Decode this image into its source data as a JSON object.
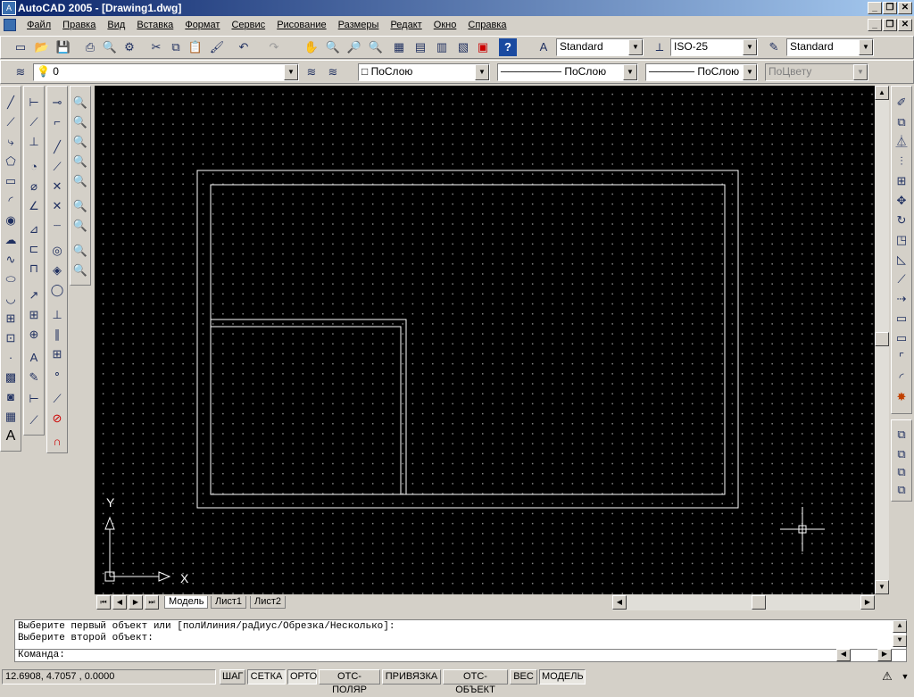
{
  "title": "AutoCAD 2005 - [Drawing1.dwg]",
  "window_controls": [
    "_",
    "❐",
    "✕"
  ],
  "menu": [
    "Файл",
    "Правка",
    "Вид",
    "Вставка",
    "Формат",
    "Сервис",
    "Рисование",
    "Размеры",
    "Редакт",
    "Окно",
    "Справка"
  ],
  "toolbar": {
    "text_style": "Standard",
    "dim_style": "ISO-25",
    "table_style": "Standard",
    "layer": "0",
    "color": "ПоСлою",
    "linetype": "ПоСлою",
    "lineweight": "ПоСлою",
    "plotstyle": "ПоЦвету"
  },
  "tabs": [
    "Модель",
    "Лист1",
    "Лист2"
  ],
  "command": {
    "line1": "Выберите первый объект или [полИлиния/раДиус/Обрезка/Несколько]:",
    "line2": "Выберите второй объект:",
    "prompt": "Команда:"
  },
  "status": {
    "coords": "12.6908, 4.7057 , 0.0000",
    "buttons": [
      {
        "label": "ШАГ",
        "on": false
      },
      {
        "label": "СЕТКА",
        "on": true
      },
      {
        "label": "ОРТО",
        "on": true
      },
      {
        "label": "ОТС-ПОЛЯР",
        "on": false
      },
      {
        "label": "ПРИВЯЗКА",
        "on": false
      },
      {
        "label": "ОТС-ОБЪЕКТ",
        "on": false
      },
      {
        "label": "ВЕС",
        "on": false
      },
      {
        "label": "МОДЕЛЬ",
        "on": true
      }
    ]
  },
  "ucs": {
    "x": "X",
    "y": "Y"
  },
  "colors": {
    "canvas": "#000000",
    "titlebar": "#0a246a",
    "chrome": "#d4d0c8"
  }
}
